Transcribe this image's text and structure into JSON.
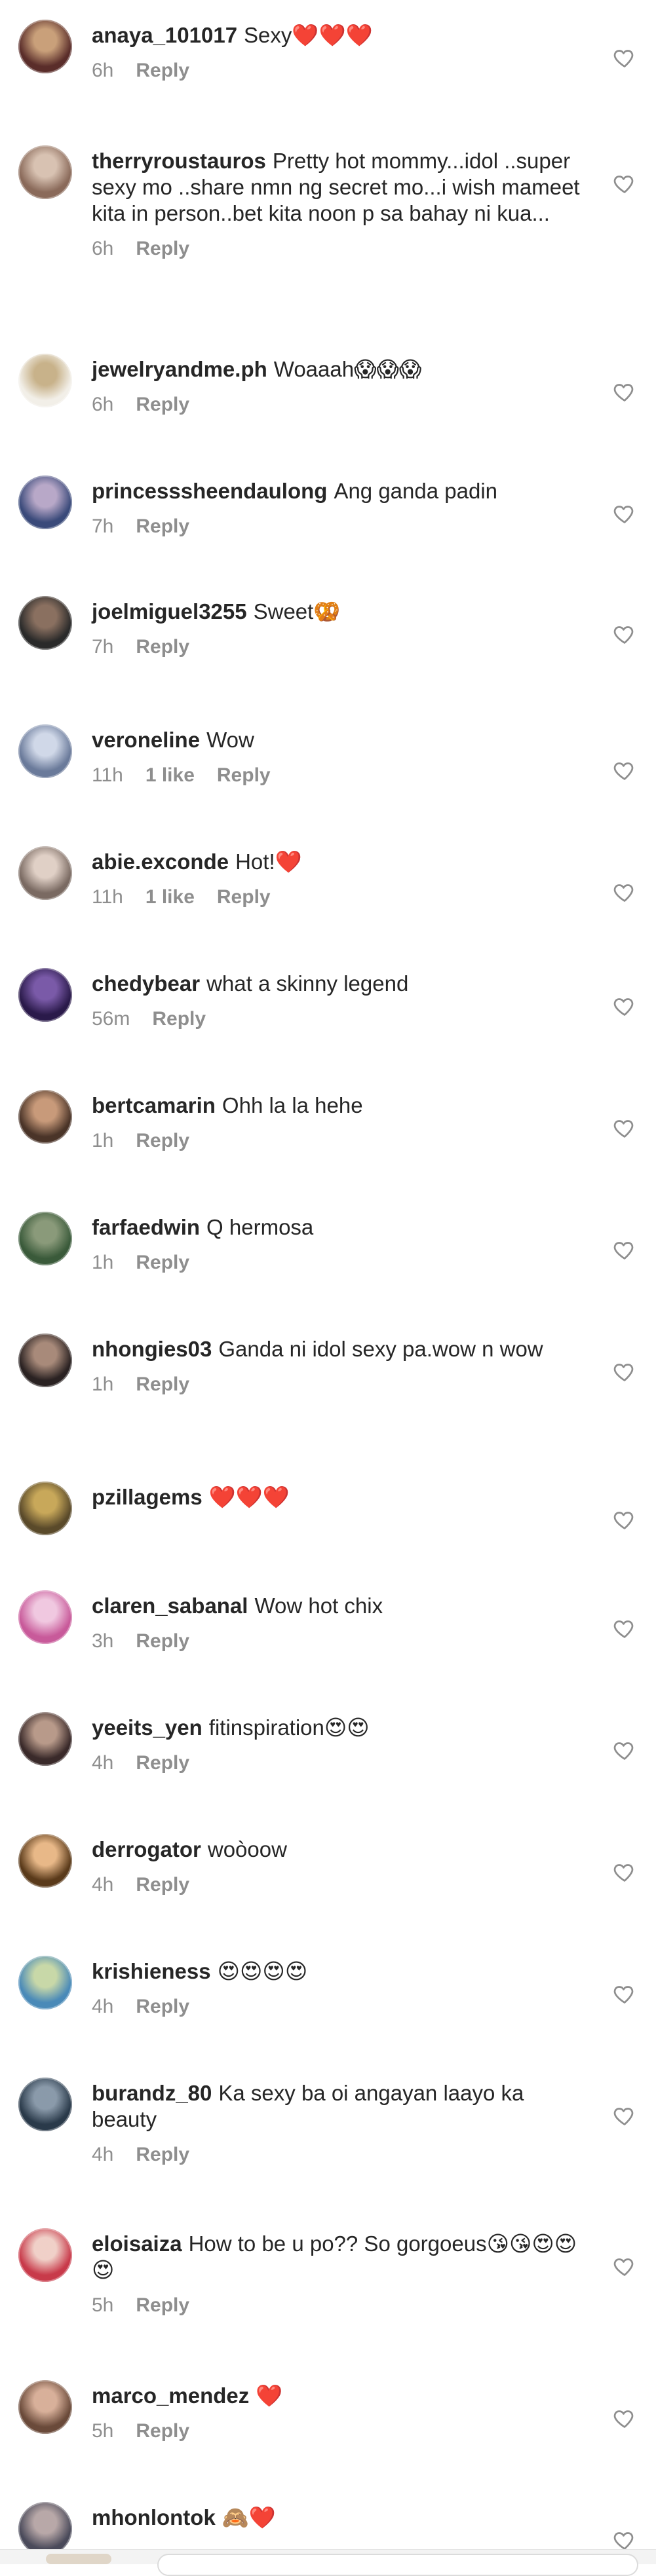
{
  "comments": [
    {
      "username": "anaya_101017",
      "text": "Sexy",
      "emoji": "❤️❤️❤️",
      "time": "6h",
      "likes": "",
      "reply": "Reply",
      "avatar_colors": [
        "#5a2d2a",
        "#c9a07a"
      ]
    },
    {
      "username": "therryroustauros",
      "text": "Pretty hot mommy...idol ..super sexy  mo ..share nmn ng secret mo...i wish mameet kita in person..bet kita noon p sa bahay ni kua...",
      "emoji": "",
      "time": "6h",
      "likes": "",
      "reply": "Reply",
      "avatar_colors": [
        "#8a6a5a",
        "#d8c2b2"
      ]
    },
    {
      "username": "jewelryandme.ph",
      "text": "Woaaah",
      "emoji": "😱😱😱",
      "time": "6h",
      "likes": "",
      "reply": "Reply",
      "avatar_colors": [
        "#f2efe8",
        "#c8b28a"
      ]
    },
    {
      "username": "princesssheendaulong",
      "text": "Ang ganda padin",
      "emoji": "",
      "time": "7h",
      "likes": "",
      "reply": "Reply",
      "avatar_colors": [
        "#3a4a7a",
        "#b8a8c8"
      ]
    },
    {
      "username": "joelmiguel3255",
      "text": "Sweet",
      "emoji": "🥨",
      "time": "7h",
      "likes": "",
      "reply": "Reply",
      "avatar_colors": [
        "#2a2a2a",
        "#8a7060"
      ]
    },
    {
      "username": "veroneline",
      "text": "Wow",
      "emoji": "",
      "time": "11h",
      "likes": "1 like",
      "reply": "Reply",
      "avatar_colors": [
        "#6a7a9a",
        "#d0d8e8"
      ]
    },
    {
      "username": "abie.exconde",
      "text": "Hot!",
      "emoji": "❤️",
      "time": "11h",
      "likes": "1 like",
      "reply": "Reply",
      "avatar_colors": [
        "#7a6a62",
        "#e0d0c6"
      ]
    },
    {
      "username": "chedybear",
      "text": "what a skinny legend",
      "emoji": "",
      "time": "56m",
      "likes": "",
      "reply": "Reply",
      "avatar_colors": [
        "#2a1a4a",
        "#7a5aa8"
      ]
    },
    {
      "username": "bertcamarin",
      "text": "Ohh la la hehe",
      "emoji": "",
      "time": "1h",
      "likes": "",
      "reply": "Reply",
      "avatar_colors": [
        "#4a3428",
        "#c89a7a"
      ]
    },
    {
      "username": "farfaedwin",
      "text": "Q hermosa",
      "emoji": "",
      "time": "1h",
      "likes": "",
      "reply": "Reply",
      "avatar_colors": [
        "#3a5a3a",
        "#8a9a7a"
      ]
    },
    {
      "username": "nhongies03",
      "text": "Ganda ni idol sexy pa.wow n wow",
      "emoji": "",
      "time": "1h",
      "likes": "",
      "reply": "Reply",
      "avatar_colors": [
        "#2a2222",
        "#a88a7a"
      ]
    },
    {
      "username": "pzillagems",
      "text": "",
      "emoji": "❤️❤️❤️",
      "time": "",
      "likes": "",
      "reply": "",
      "avatar_colors": [
        "#5a4a2a",
        "#c8a85a"
      ]
    },
    {
      "username": "claren_sabanal",
      "text": "Wow hot chix",
      "emoji": "",
      "time": "3h",
      "likes": "",
      "reply": "Reply",
      "avatar_colors": [
        "#c85a9a",
        "#f0c8e0"
      ]
    },
    {
      "username": "yeeits_yen",
      "text": "fitinspiration",
      "emoji": "😍😍",
      "time": "4h",
      "likes": "",
      "reply": "Reply",
      "avatar_colors": [
        "#3a2a2a",
        "#b89a8a"
      ]
    },
    {
      "username": "derrogator",
      "text": "woòoow",
      "emoji": "",
      "time": "4h",
      "likes": "",
      "reply": "Reply",
      "avatar_colors": [
        "#5a3a1a",
        "#e8b888"
      ]
    },
    {
      "username": "krishieness",
      "text": "",
      "emoji": "😍😍😍😍",
      "time": "4h",
      "likes": "",
      "reply": "Reply",
      "avatar_colors": [
        "#4a8ab8",
        "#c8d8a8"
      ]
    },
    {
      "username": "burandz_80",
      "text": "Ka sexy ba oi angayan laayo ka beauty",
      "emoji": "",
      "time": "4h",
      "likes": "",
      "reply": "Reply",
      "avatar_colors": [
        "#2a3a4a",
        "#8a9aaa"
      ]
    },
    {
      "username": "eloisaiza",
      "text": "How to be u po?? So gorgoeus",
      "emoji": "😘😘😍😍😍",
      "time": "5h",
      "likes": "",
      "reply": "Reply",
      "avatar_colors": [
        "#c83a4a",
        "#f0d0c8"
      ]
    },
    {
      "username": "marco_mendez",
      "text": "",
      "emoji": "❤️",
      "time": "5h",
      "likes": "",
      "reply": "Reply",
      "avatar_colors": [
        "#6a4a3a",
        "#d8b09a"
      ]
    },
    {
      "username": "mhonlontok",
      "text": "",
      "emoji": "🙈❤️",
      "time": "",
      "likes": "",
      "reply": "",
      "avatar_colors": [
        "#4a4a5a",
        "#b8a8a8"
      ]
    }
  ]
}
